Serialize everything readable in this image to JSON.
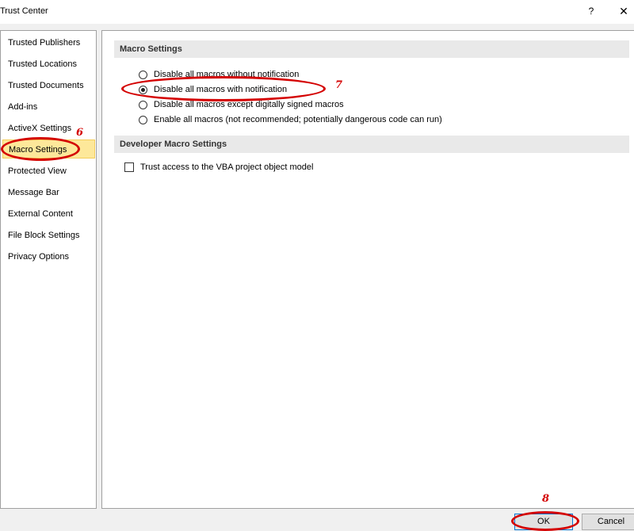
{
  "window": {
    "title": "Trust Center",
    "help_label": "?",
    "close_label": "✕"
  },
  "sidebar": {
    "items": [
      {
        "label": "Trusted Publishers"
      },
      {
        "label": "Trusted Locations"
      },
      {
        "label": "Trusted Documents"
      },
      {
        "label": "Add-ins"
      },
      {
        "label": "ActiveX Settings"
      },
      {
        "label": "Macro Settings",
        "selected": true
      },
      {
        "label": "Protected View"
      },
      {
        "label": "Message Bar"
      },
      {
        "label": "External Content"
      },
      {
        "label": "File Block Settings"
      },
      {
        "label": "Privacy Options"
      }
    ]
  },
  "macro_settings": {
    "header": "Macro Settings",
    "options": [
      {
        "label": "Disable all macros without notification",
        "checked": false
      },
      {
        "label": "Disable all macros with notification",
        "checked": true
      },
      {
        "label": "Disable all macros except digitally signed macros",
        "checked": false
      },
      {
        "label": "Enable all macros (not recommended; potentially dangerous code can run)",
        "checked": false
      }
    ]
  },
  "developer_macro_settings": {
    "header": "Developer Macro Settings",
    "trust_vba_label": "Trust access to the VBA project object model",
    "trust_vba_checked": false
  },
  "buttons": {
    "ok_label": "OK",
    "cancel_label": "Cancel"
  },
  "annotations": {
    "step_6": "6",
    "step_7": "7",
    "step_8": "8",
    "color": "#d40000"
  },
  "colors": {
    "selected_nav_bg": "#fde89a",
    "section_header_bg": "#e9e9e9",
    "ok_border": "#0078d7"
  }
}
